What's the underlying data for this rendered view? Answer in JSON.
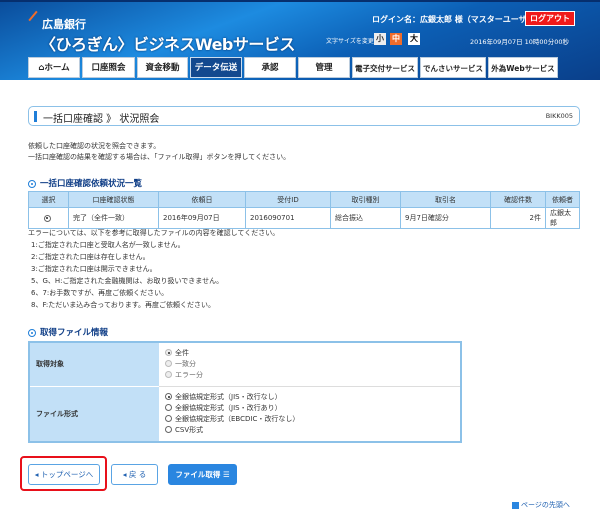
{
  "header": {
    "bank": "広島銀行",
    "service": "〈ひろぎん〉ビジネスWebサービス",
    "login": "ログイン名：広銀太郎 様（マスターユーザ）",
    "logout": "ログアウト",
    "font_size_label": "文字サイズを変更",
    "font_sizes": [
      "小",
      "中",
      "大"
    ],
    "datetime": "2016年09月07日 10時00分00秒"
  },
  "nav": [
    "ホーム",
    "口座照会",
    "資金移動",
    "データ伝送",
    "承認",
    "管理",
    "電子交付サービス",
    "でんさいサービス",
    "外為Webサービス"
  ],
  "nav_selected": "データ伝送",
  "page": {
    "title": "一括口座確認 》 状況照会",
    "id": "BIKK005",
    "desc1": "依頼した口座確認の状況を照会できます。",
    "desc2": "一括口座確認の結果を確認する場合は、「ファイル取得」ボタンを押してください。"
  },
  "list": {
    "heading": "一括口座確認依頼状況一覧",
    "headers": [
      "選択",
      "口座確認状態",
      "依頼日",
      "受付ID",
      "取引種別",
      "取引名",
      "確認件数",
      "依頼者"
    ],
    "rows": [
      {
        "status": "完了（全件一致）",
        "date": "2016年09月07日",
        "id": "2016090701",
        "type": "総合振込",
        "name": "9月7日確認分",
        "count": "2件",
        "requester": "広銀太郎"
      }
    ]
  },
  "errors": [
    "エラーについては、以下を参考に取得したファイルの内容を確認してください。",
    "1:ご指定された口座と受取人名が一致しません。",
    "2:ご指定された口座は存在しません。",
    "3:ご指定された口座は開示できません。",
    "5、G、H:ご指定された金融機関は、お取り扱いできません。",
    "6、7:お手数ですが、再度ご依頼ください。",
    "8、F:ただいま込み合っております。再度ご依頼ください。"
  ],
  "file": {
    "heading": "取得ファイル情報",
    "target_label": "取得対象",
    "targets": [
      "全件",
      "一致分",
      "エラー分"
    ],
    "format_label": "ファイル形式",
    "formats": [
      "全銀協規定形式（JIS・改行なし）",
      "全銀協規定形式（JIS・改行あり）",
      "全銀協規定形式（EBCDIC・改行なし）",
      "CSV形式"
    ]
  },
  "buttons": {
    "top": "トップページへ",
    "back": "戻 る",
    "get_file": "ファイル取得"
  },
  "footer": {
    "to_top": "ページの先頭へ"
  },
  "colors": {
    "accent": "#1f7ed8",
    "header": "#0c5fb5",
    "logout": "#f01a1a",
    "highlight": "#e8101a"
  }
}
